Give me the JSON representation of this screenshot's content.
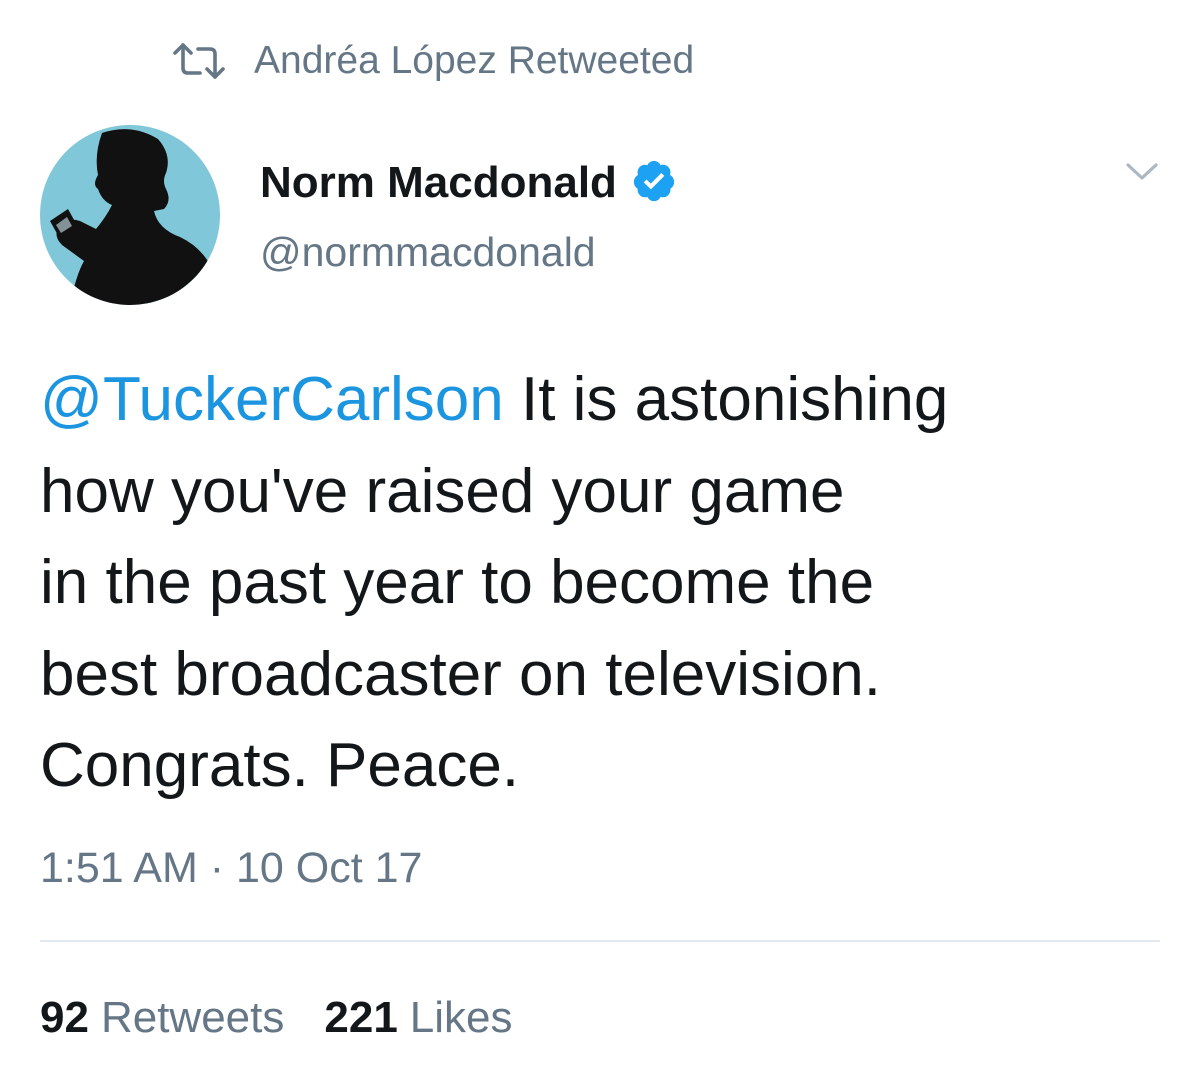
{
  "retweet_context": {
    "icon": "retweet-icon",
    "text": "Andréa López Retweeted"
  },
  "author": {
    "avatar_icon": "profile-avatar",
    "display_name": "Norm Macdonald",
    "verified_icon": "verified-badge-icon",
    "handle": "@normmacdonald"
  },
  "menu": {
    "icon": "chevron-down-icon"
  },
  "tweet": {
    "mention": "@TuckerCarlson",
    "line1_rest": " It is astonishing",
    "line2": "how you've raised your game",
    "line3": "in the past year to become the",
    "line4": "best broadcaster on television.",
    "line5": "Congrats. Peace.",
    "timestamp": "1:51 AM · 10 Oct 17"
  },
  "stats": {
    "retweets_count": "92",
    "retweets_label": "Retweets",
    "likes_count": "221",
    "likes_label": "Likes"
  },
  "colors": {
    "link": "#1b95e0",
    "secondary_text": "#657786",
    "primary_text": "#14171a",
    "verified": "#1da1f2",
    "avatar_bg": "#79c3d6",
    "divider": "#e1e8ed"
  }
}
